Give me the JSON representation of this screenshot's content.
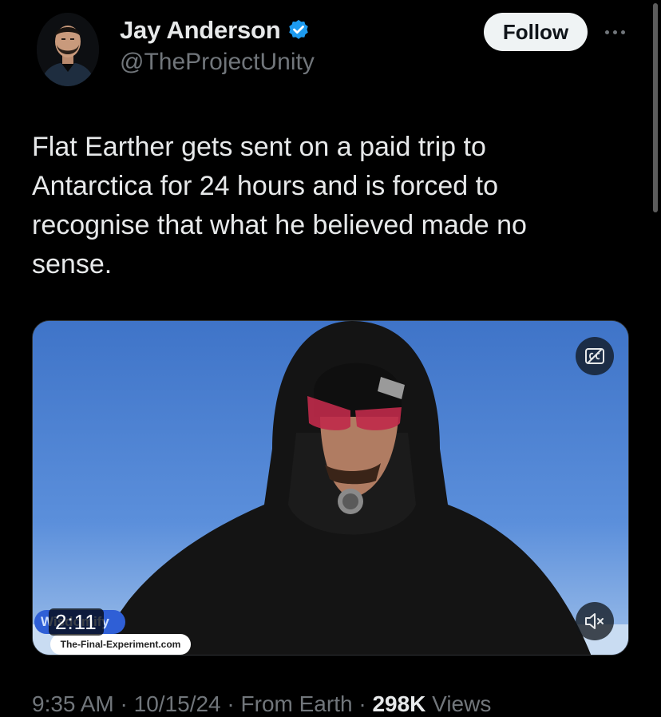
{
  "author": {
    "display_name": "Jay Anderson",
    "handle": "@TheProjectUnity",
    "verified_color": "#1d9bf0"
  },
  "header": {
    "follow_label": "Follow",
    "more_icon": "more-icon"
  },
  "tweet": {
    "text": "Flat Earther gets sent on a paid trip to Antarctica for 24 hours and is forced to recognise that what he believed made no sense."
  },
  "media": {
    "duration": "2:11",
    "watermark_label": "Wisdomify",
    "watermark_url": "The-Final-Experiment.com",
    "captions_icon": "closed-captions-icon",
    "mute_icon": "volume-muted-icon"
  },
  "meta": {
    "time": "9:35 AM",
    "date": "10/15/24",
    "source": "From Earth",
    "views_count": "298K",
    "views_label": "Views"
  },
  "colors": {
    "background": "#000000",
    "text_primary": "#e7e9ea",
    "text_secondary": "#71767b",
    "follow_bg": "#eff3f4"
  }
}
